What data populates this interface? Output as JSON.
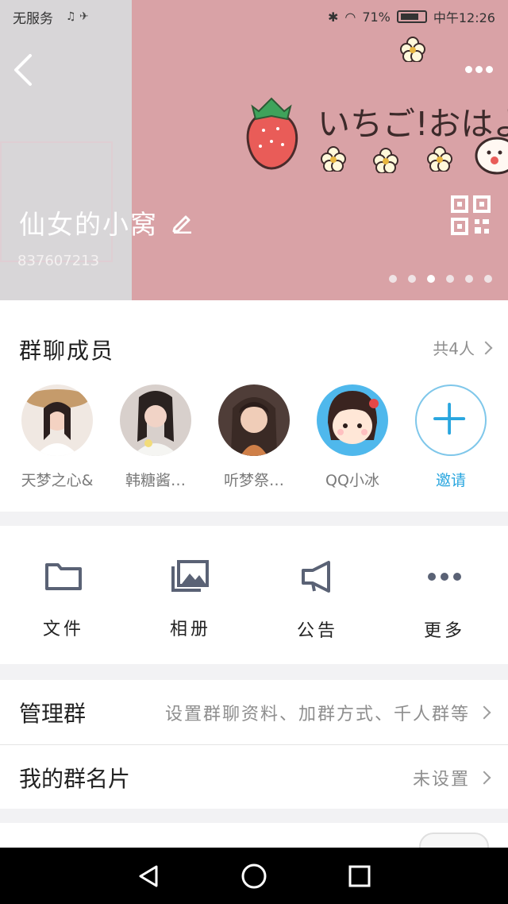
{
  "status": {
    "carrier": "无服务",
    "battery": "71%",
    "time": "中午12:26"
  },
  "header": {
    "group_name": "仙女的小窝",
    "group_id": "837607213",
    "banner_text": "いちご!おはよう"
  },
  "members": {
    "title": "群聊成员",
    "count": "共4人",
    "items": [
      {
        "name": "天梦之心&"
      },
      {
        "name": "韩糖酱…"
      },
      {
        "name": "听梦祭…"
      },
      {
        "name": "QQ小冰"
      }
    ],
    "invite_label": "邀请"
  },
  "actions": {
    "files": "文件",
    "album": "相册",
    "notice": "公告",
    "more": "更多"
  },
  "settings": {
    "manage_label": "管理群",
    "manage_value": "设置群聊资料、加群方式、千人群等",
    "card_label": "我的群名片",
    "card_value": "未设置"
  },
  "colors": {
    "banner": "#d9a2a6",
    "accent": "#29a6df"
  },
  "icons": {
    "back": "chevron-left-icon",
    "more": "more-horizontal-icon",
    "edit": "pencil-icon",
    "qr": "qr-code-icon",
    "files": "folder-icon",
    "album": "image-gallery-icon",
    "notice": "megaphone-icon",
    "more_actions": "ellipsis-icon"
  }
}
